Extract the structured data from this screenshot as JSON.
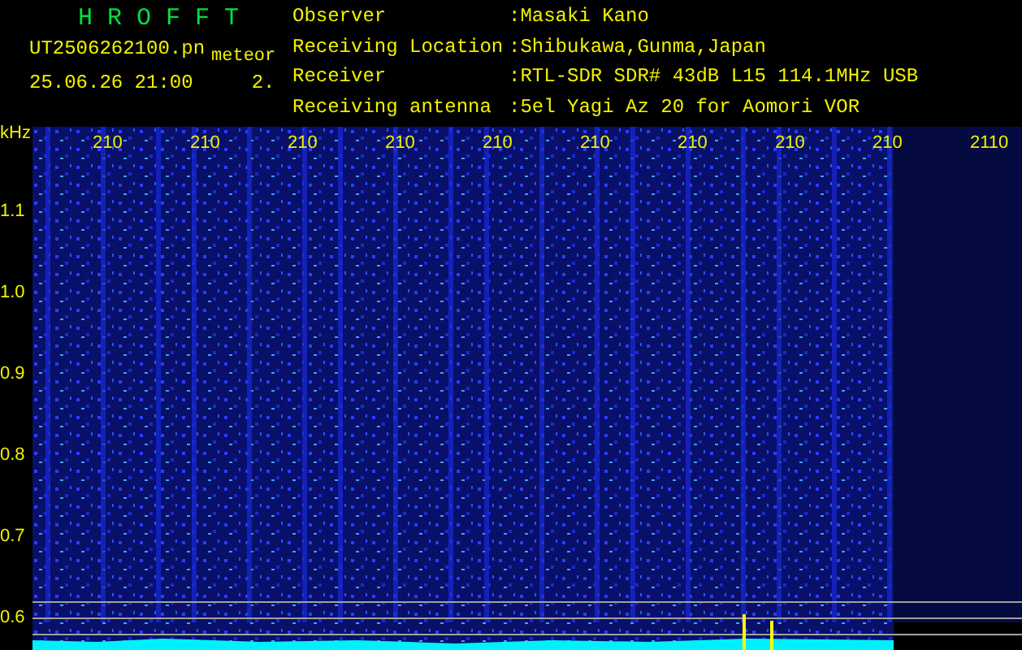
{
  "header": {
    "title": "H R O F F T",
    "filename": "UT2506262100.pn",
    "mode": "meteor",
    "datetime": "25.06.26 21:00",
    "value": "2."
  },
  "info": [
    {
      "label": "Observer",
      "value": ":Masaki Kano"
    },
    {
      "label": "Receiving Location",
      "value": ":Shibukawa,Gunma,Japan"
    },
    {
      "label": "Receiver",
      "value": ":RTL-SDR SDR# 43dB L15 114.1MHz USB"
    },
    {
      "label": "Receiving antenna",
      "value": ":5el Yagi Az 20 for Aomori VOR"
    }
  ],
  "y_axis": {
    "unit": "kHz",
    "labels": [
      "1.1",
      "1.0",
      "0.9",
      "0.8",
      "0.7",
      "0.6"
    ]
  },
  "x_axis": {
    "labels": [
      "210",
      "210",
      "210",
      "210",
      "210",
      "210",
      "210",
      "210",
      "210",
      "2110"
    ]
  }
}
